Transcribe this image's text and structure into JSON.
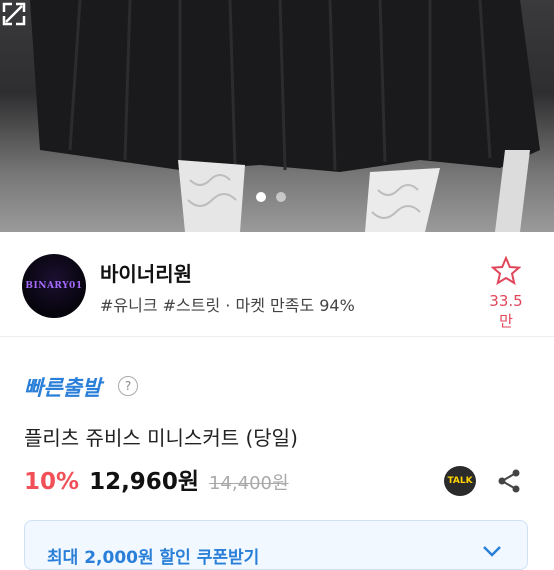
{
  "carousel": {
    "total": 2,
    "active": 1
  },
  "seller": {
    "avatar_text": "BINARY01",
    "name": "바이너리원",
    "subtitle": "#유니크 #스트릿 · 마켓 만족도 94%",
    "favorite_count": "33.5만"
  },
  "product": {
    "fast_label": "빠른출발",
    "help_glyph": "?",
    "title": "플리츠 쥬비스 미니스커트 (당일)",
    "discount": "10%",
    "price": "12,960원",
    "original_price": "14,400원",
    "talk_label": "TALK"
  },
  "coupon": {
    "label": "최대 2,000원 할인 쿠폰받기"
  },
  "colors": {
    "accent_blue": "#2a7fd9",
    "discount_red": "#f15058",
    "favorite_red": "#e0475a"
  }
}
